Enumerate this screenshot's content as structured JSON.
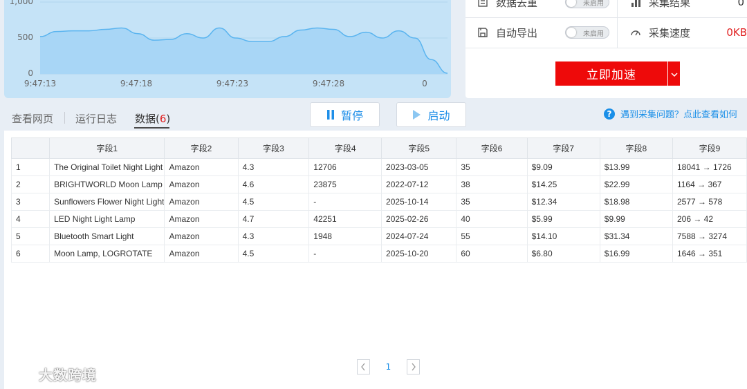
{
  "chart": {
    "y_ticks": [
      "1,000",
      "500",
      "0"
    ],
    "x_ticks": [
      "9:47:13",
      "9:47:18",
      "9:47:23",
      "9:47:28",
      "0"
    ],
    "fill_color": "#a8d6f6",
    "line_color": "#5ab4ef"
  },
  "chart_data": {
    "type": "area",
    "x": [
      "9:47:13",
      "9:47:18",
      "9:47:23",
      "9:47:28",
      "0"
    ],
    "ylim": [
      0,
      1000
    ],
    "values": [
      520,
      590,
      600,
      600,
      620,
      640,
      560,
      470,
      480,
      560,
      500,
      640,
      500,
      450,
      450,
      520,
      610,
      640,
      620,
      520,
      580,
      500,
      600,
      500,
      200,
      10
    ],
    "title": "",
    "xlabel": "",
    "ylabel": ""
  },
  "settings": {
    "row1": {
      "left_label": "数据去重",
      "left_toggle": "未启用",
      "right_label": "采集结果",
      "right_value": "0"
    },
    "row2": {
      "left_label": "自动导出",
      "left_toggle": "未启用",
      "right_label": "采集速度",
      "right_value": "0KB"
    },
    "boost_label": "立即加速",
    "accent_red": "#ee0a0a"
  },
  "tabs": {
    "view_page": "查看网页",
    "run_log": "运行日志",
    "data_label": "数据(",
    "data_count": "6",
    "data_close": ")"
  },
  "controls": {
    "pause_label": "暂停",
    "start_label": "启动",
    "help_text": "遇到采集问题？点此查看如何"
  },
  "table": {
    "headers": [
      "",
      "字段1",
      "字段2",
      "字段3",
      "字段4",
      "字段5",
      "字段6",
      "字段7",
      "字段8",
      "字段9"
    ],
    "rows": [
      [
        "1",
        "The Original Toilet Night Light",
        "Amazon",
        "4.3",
        "12706",
        "2023-03-05",
        "35",
        "$9.09",
        "$13.99",
        "18041 → 1726"
      ],
      [
        "2",
        "BRIGHTWORLD Moon Lamp",
        "Amazon",
        "4.6",
        "23875",
        "2022-07-12",
        "38",
        "$14.25",
        "$22.99",
        "1164 → 367"
      ],
      [
        "3",
        "Sunflowers Flower Night Light",
        "Amazon",
        "4.5",
        "-",
        "2025-10-14",
        "35",
        "$12.34",
        "$18.98",
        "2577 → 578"
      ],
      [
        "4",
        "LED Night Light Lamp",
        "Amazon",
        "4.7",
        "42251",
        "2025-02-26",
        "40",
        "$5.99",
        "$9.99",
        "206 → 42"
      ],
      [
        "5",
        "Bluetooth Smart Light",
        "Amazon",
        "4.3",
        "1948",
        "2024-07-24",
        "55",
        "$14.10",
        "$31.34",
        "7588 → 3274"
      ],
      [
        "6",
        "Moon Lamp, LOGROTATE",
        "Amazon",
        "4.5",
        "-",
        "2025-10-20",
        "60",
        "$6.80",
        "$16.99",
        "1646 → 351"
      ]
    ]
  },
  "pagination": {
    "current_page": "1"
  },
  "watermark": {
    "text": "大数跨境"
  }
}
